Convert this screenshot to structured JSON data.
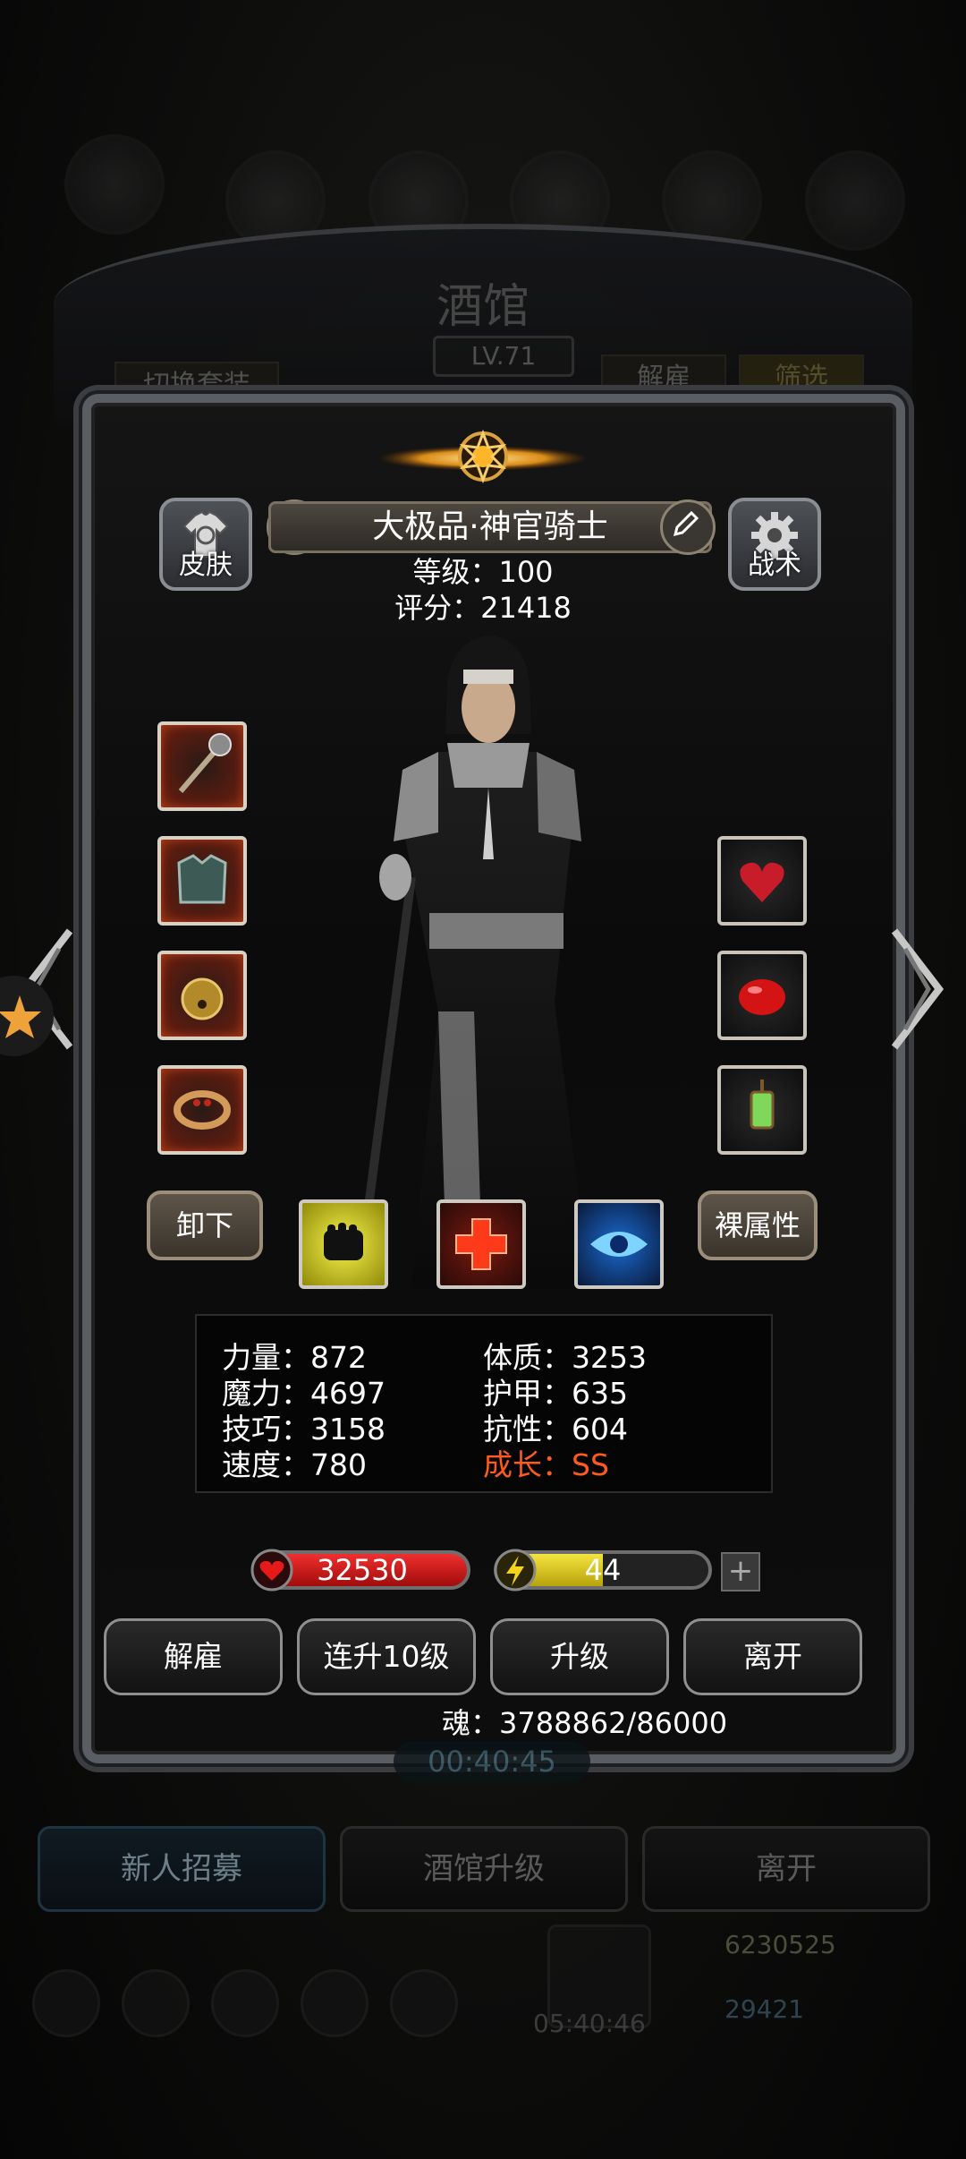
{
  "background": {
    "title": "酒馆",
    "level": "LV.71",
    "switch_outfit": "切换套装",
    "dismiss": "解雇",
    "filter": "筛选",
    "timer": "00:40:45",
    "buttons": [
      "新人招募",
      "酒馆升级",
      "离开"
    ],
    "gold": "6230525",
    "gems": "29421",
    "chest_timer": "05:40:46"
  },
  "hero": {
    "name": "大极品·神官骑士",
    "level_text": "等级：100",
    "score_text": "评分：21418",
    "skin_label": "皮肤",
    "tactics_label": "战术",
    "unequip_label": "卸下",
    "base_attr_label": "裸属性"
  },
  "equipment": {
    "left": [
      "mace-icon",
      "armor-icon",
      "bell-icon",
      "ring-icon"
    ],
    "right": [
      "heart-gem-icon",
      "red-stone-icon",
      "lantern-icon"
    ]
  },
  "skills": [
    "fist-icon",
    "red-cross-icon",
    "blue-eye-icon"
  ],
  "stats": {
    "strength": "力量：872",
    "magic": "魔力：4697",
    "skill": "技巧：3158",
    "speed": "速度：780",
    "constitution": "体质：3253",
    "armor": "护甲：635",
    "resistance": "抗性：604",
    "growth": "成长：SS"
  },
  "bars": {
    "hp": "32530",
    "energy": "44",
    "energy_fill": 0.5
  },
  "actions": [
    "解雇",
    "连升10级",
    "升级",
    "离开"
  ],
  "soul": "魂：3788862/86000",
  "colors": {
    "growth": "#ff5a1e",
    "hp": "#d41414",
    "energy": "#e8d21c"
  }
}
